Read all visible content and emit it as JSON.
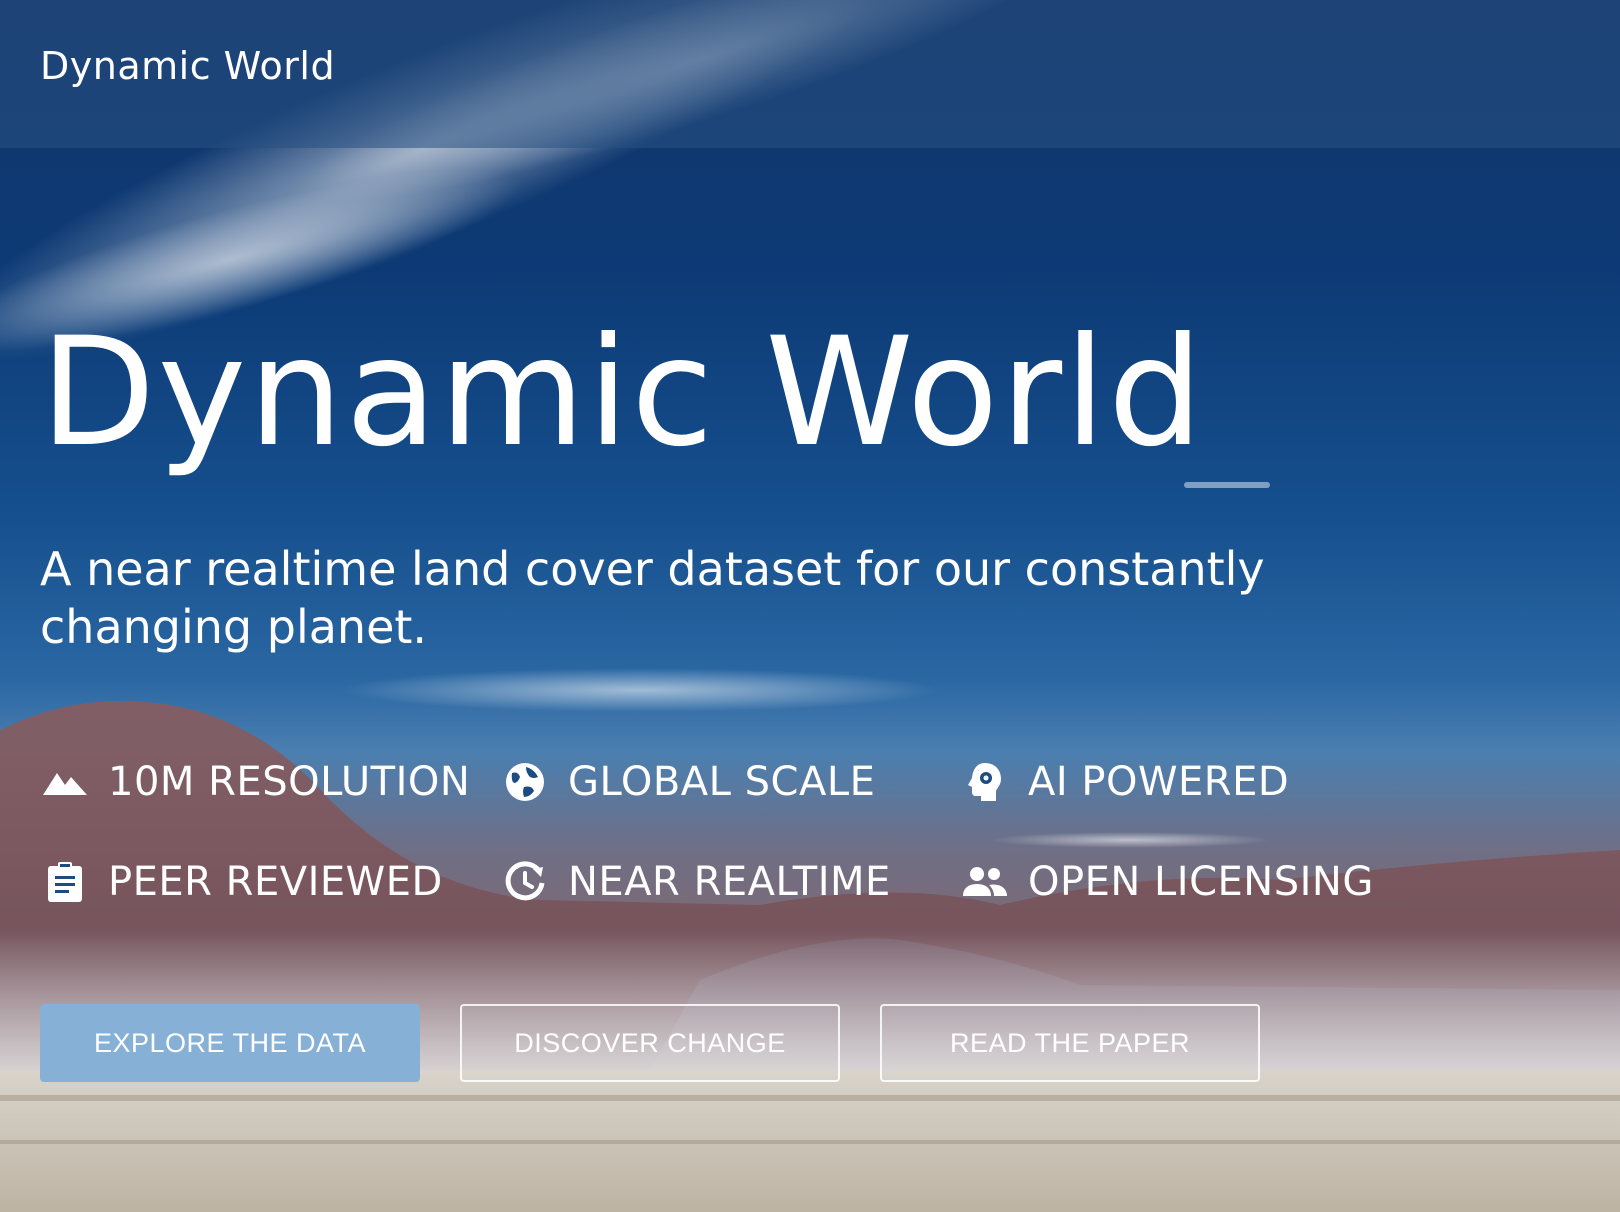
{
  "header": {
    "brand": "Dynamic World"
  },
  "hero": {
    "title": "Dynamic World",
    "subtitle": "A near realtime land cover dataset for our constantly changing planet."
  },
  "features": [
    {
      "label": "10M RESOLUTION",
      "icon": "mountain-icon"
    },
    {
      "label": "GLOBAL SCALE",
      "icon": "globe-icon"
    },
    {
      "label": "AI POWERED",
      "icon": "ai-head-icon"
    },
    {
      "label": "PEER REVIEWED",
      "icon": "clipboard-icon"
    },
    {
      "label": "NEAR REALTIME",
      "icon": "clock-refresh-icon"
    },
    {
      "label": "OPEN LICENSING",
      "icon": "people-icon"
    }
  ],
  "buttons": {
    "explore": "EXPLORE THE DATA",
    "discover": "DISCOVER CHANGE",
    "paper": "READ THE PAPER"
  },
  "colors": {
    "primary_button": "#86b0d6",
    "sky": "#0d3a75",
    "text": "#ffffff"
  }
}
